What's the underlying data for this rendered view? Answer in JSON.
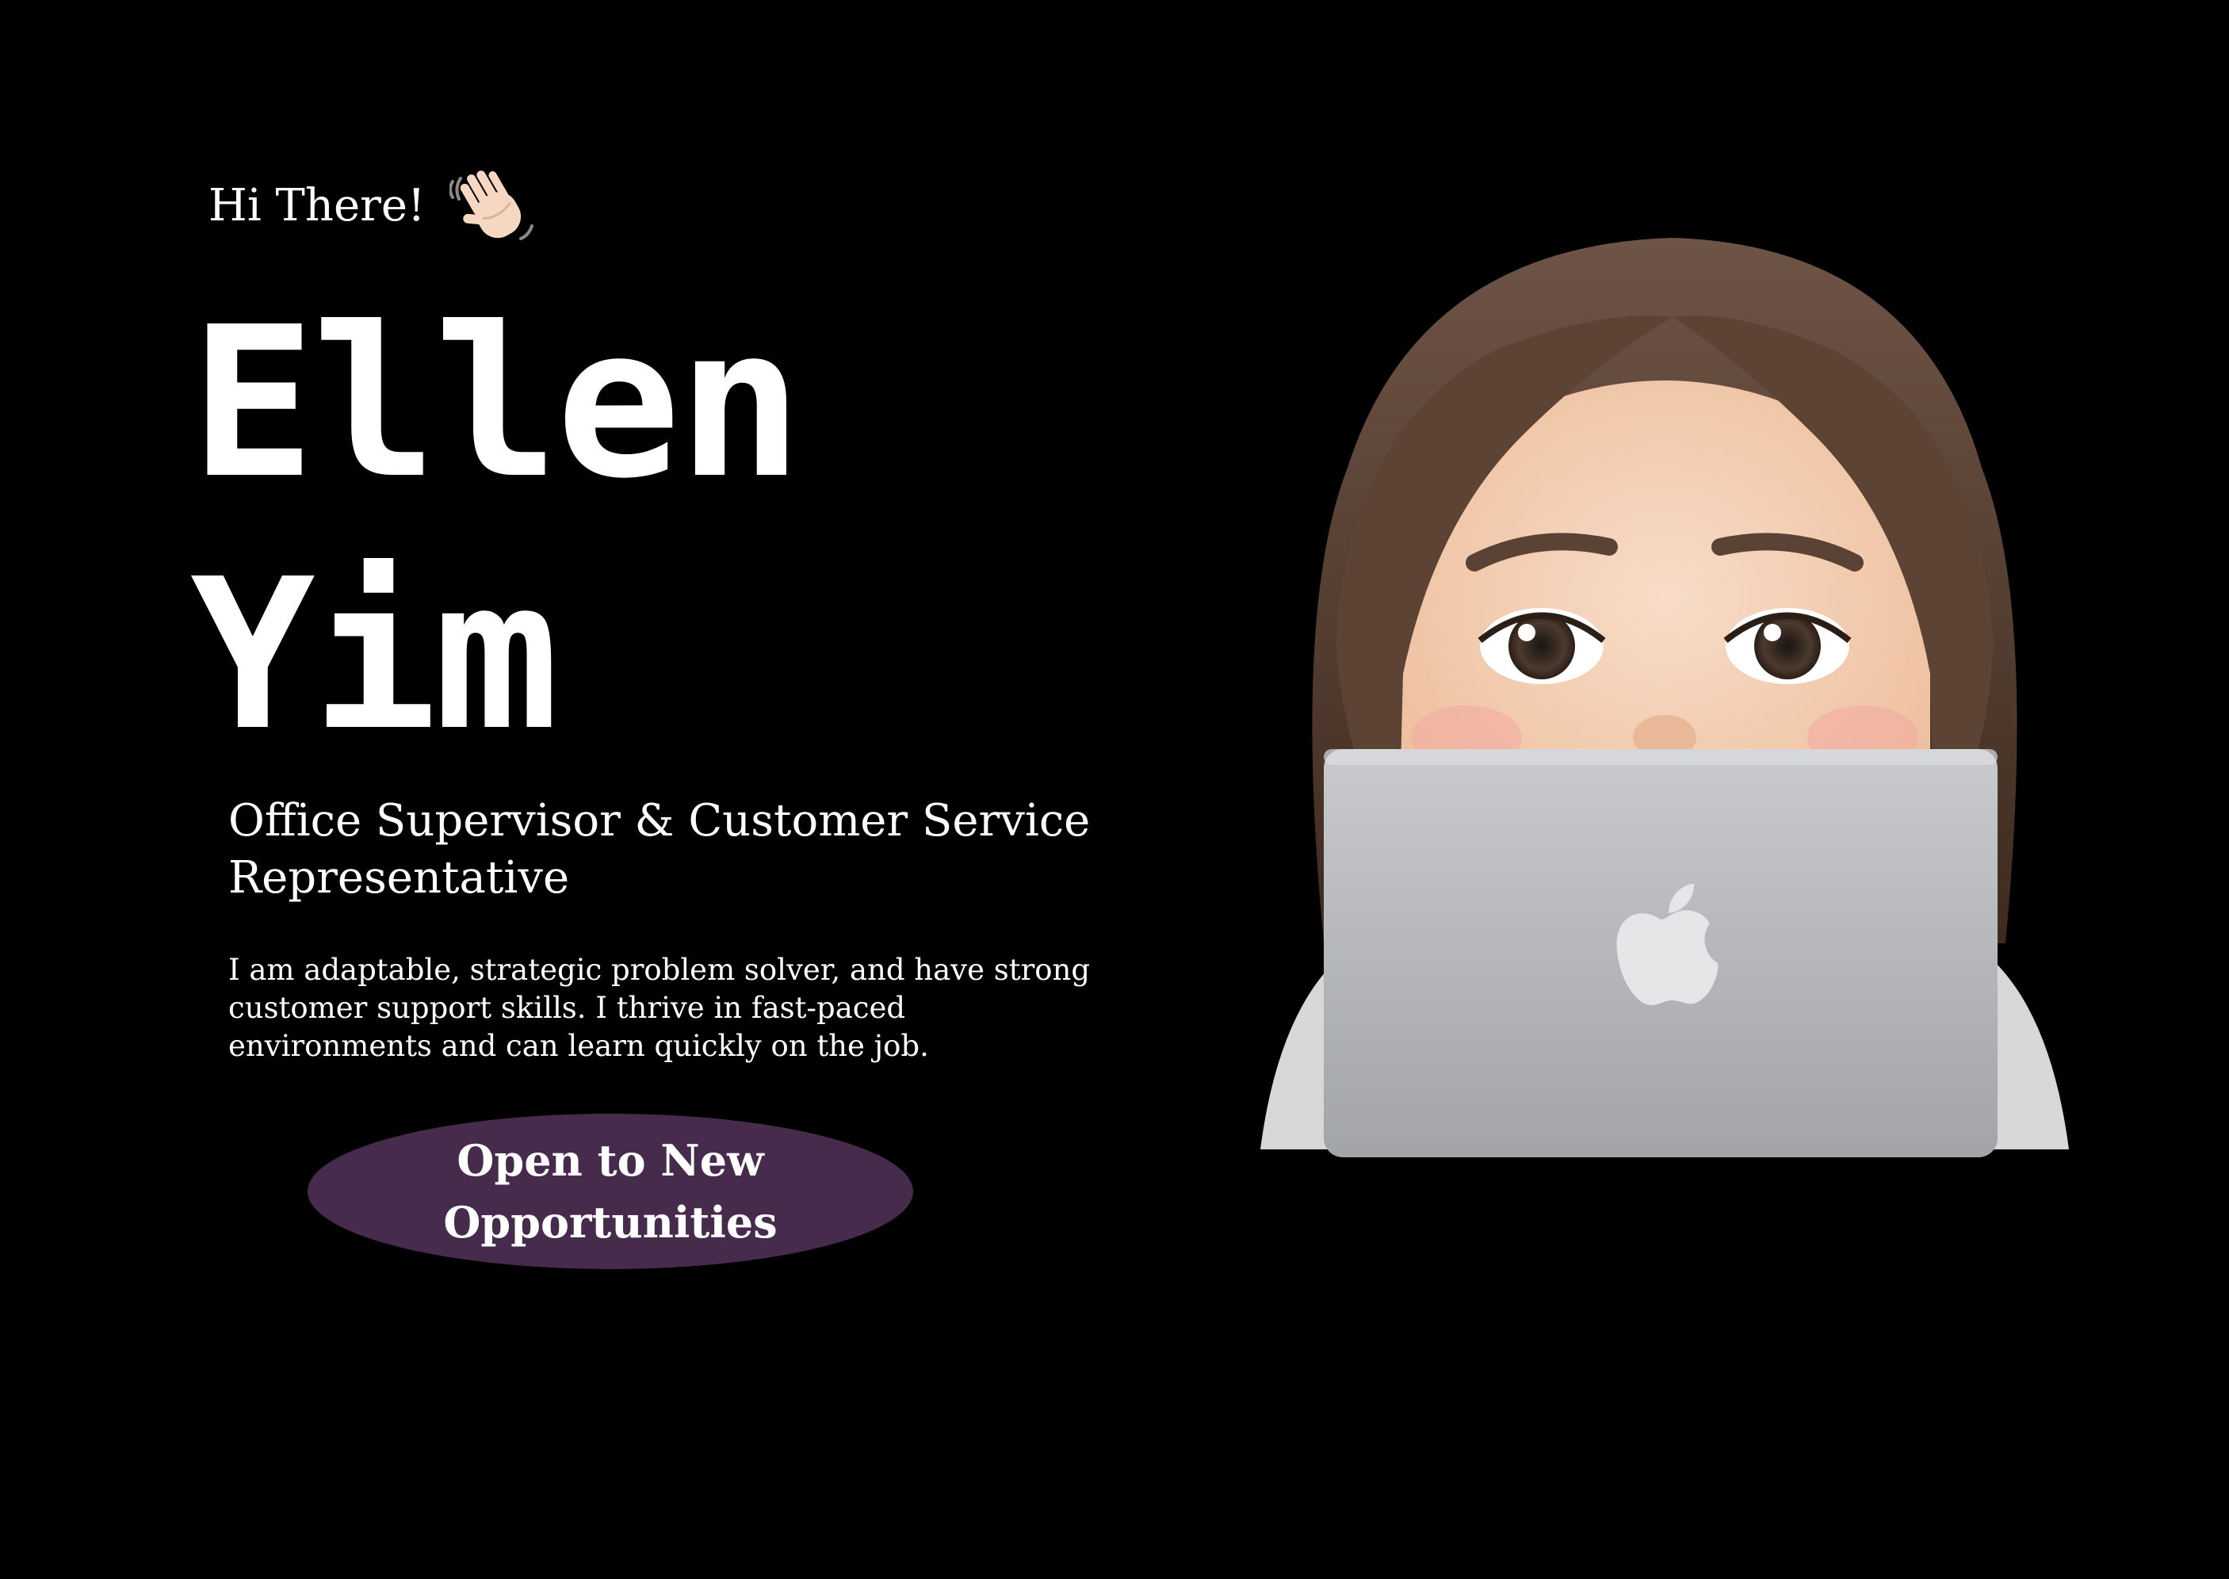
{
  "header": {
    "greeting": "Hi There!",
    "greeting_icon": "waving-hand-icon"
  },
  "hero": {
    "name_first": "Ellen",
    "name_last": "Yim",
    "role": "Office Supervisor & Customer Service Representative",
    "bio": "I am adaptable, strategic problem solver, and have strong customer support skills.  I thrive in fast-paced environments and can learn quickly on the job.",
    "cta_label": "Open to New Opportunities"
  },
  "colors": {
    "background": "#000000",
    "text": "#ffffff",
    "badge": "#472b4c"
  },
  "avatar": {
    "icon": "memoji-laptop-avatar-icon"
  }
}
